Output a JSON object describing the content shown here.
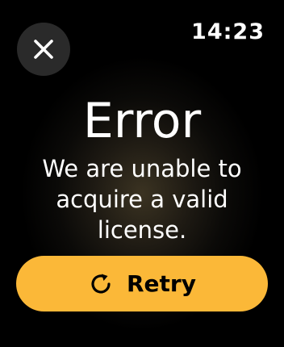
{
  "status_bar": {
    "time": "14:23"
  },
  "close_button": {
    "icon": "close-icon"
  },
  "error": {
    "title": "Error",
    "message": "We are unable to acquire a valid license."
  },
  "retry_button": {
    "label": "Retry",
    "icon": "refresh-icon",
    "color": "#fbb838"
  }
}
